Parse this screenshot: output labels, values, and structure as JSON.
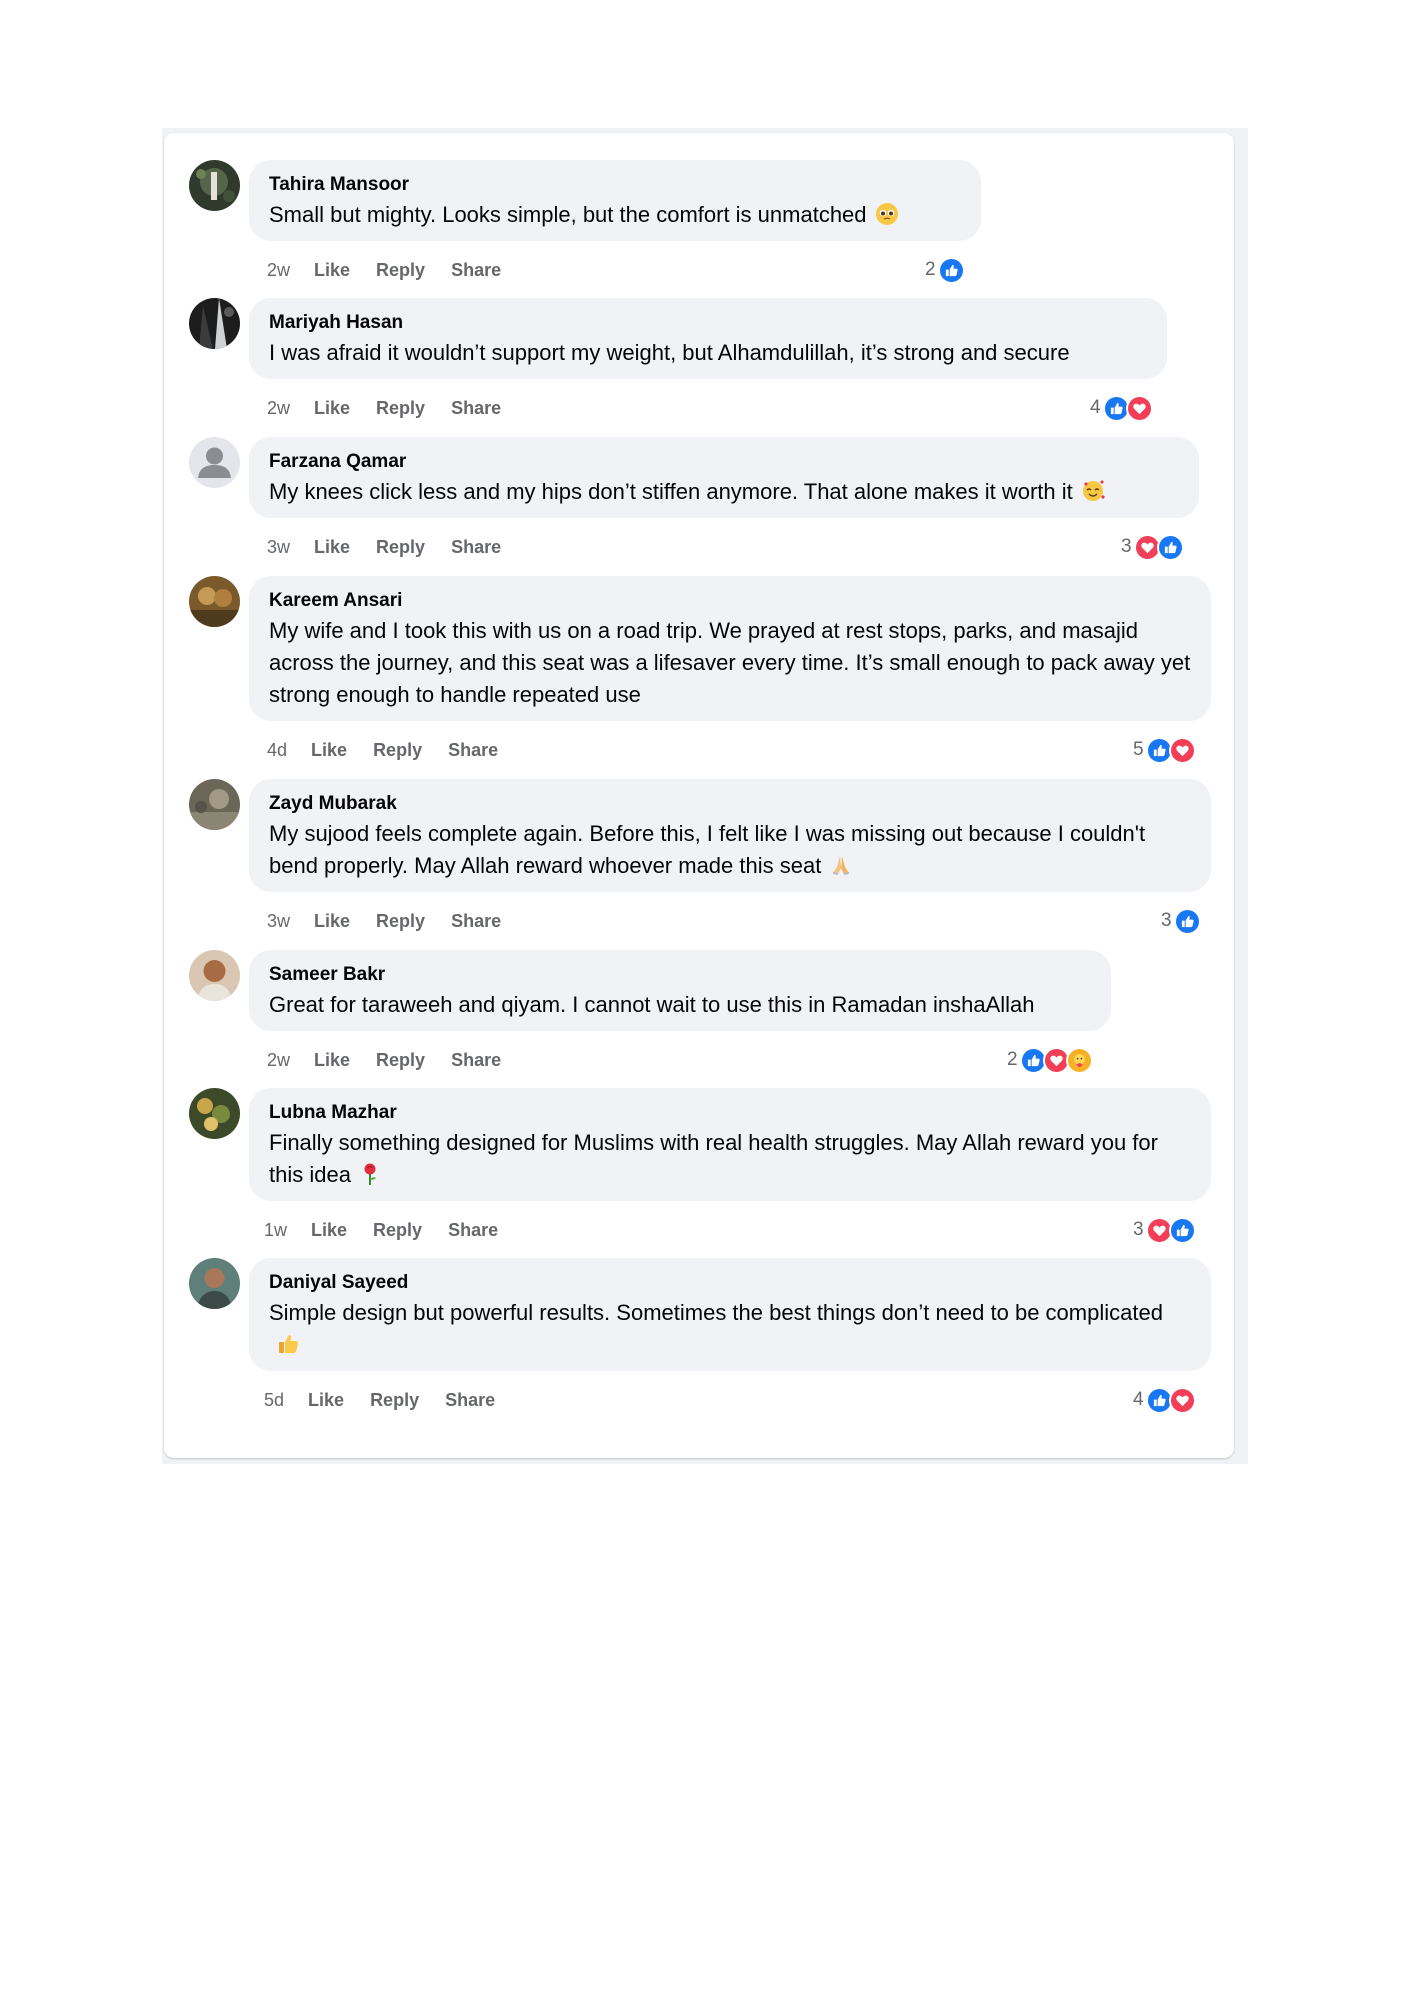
{
  "comments": [
    {
      "author": "Tahira Mansoor",
      "text": "Small but mighty. Looks simple, but the comfort is unmatched",
      "emoji": "pleading-face-emoji",
      "time": "2w",
      "like_label": "Like",
      "reply_label": "Reply",
      "share_label": "Share",
      "reaction_count": "2",
      "reactions": [
        "like"
      ]
    },
    {
      "author": "Mariyah Hasan",
      "text": "I was afraid it wouldn’t support my weight, but Alhamdulillah, it’s strong and secure",
      "emoji": "",
      "time": "2w",
      "like_label": "Like",
      "reply_label": "Reply",
      "share_label": "Share",
      "reaction_count": "4",
      "reactions": [
        "like",
        "love"
      ]
    },
    {
      "author": "Farzana Qamar",
      "text": "My knees click less and my hips don’t stiffen anymore. That alone makes it worth it",
      "emoji": "smiling-face-with-hearts-emoji",
      "time": "3w",
      "like_label": "Like",
      "reply_label": "Reply",
      "share_label": "Share",
      "reaction_count": "3",
      "reactions": [
        "love",
        "like"
      ]
    },
    {
      "author": "Kareem Ansari",
      "text": "My wife and I took this with us on a road trip. We prayed at rest stops, parks, and masajid across the journey, and this seat was a lifesaver every time. It’s small enough to pack away yet strong enough to handle repeated use",
      "emoji": "",
      "time": "4d",
      "like_label": "Like",
      "reply_label": "Reply",
      "share_label": "Share",
      "reaction_count": "5",
      "reactions": [
        "like",
        "love"
      ]
    },
    {
      "author": "Zayd Mubarak",
      "text": "My sujood feels complete again. Before this, I felt like I was missing out because I couldn't bend properly. May Allah reward whoever made this seat",
      "emoji": "folded-hands-emoji",
      "time": "3w",
      "like_label": "Like",
      "reply_label": "Reply",
      "share_label": "Share",
      "reaction_count": "3",
      "reactions": [
        "like"
      ]
    },
    {
      "author": "Sameer Bakr",
      "text": "Great for taraweeh and qiyam. I cannot wait to use this in Ramadan inshaAllah",
      "emoji": "",
      "time": "2w",
      "like_label": "Like",
      "reply_label": "Reply",
      "share_label": "Share",
      "reaction_count": "2",
      "reactions": [
        "like",
        "love",
        "care"
      ]
    },
    {
      "author": "Lubna Mazhar",
      "text": "Finally something designed for Muslims with real health struggles. May Allah reward you for this idea",
      "emoji": "rose-emoji",
      "time": "1w",
      "like_label": "Like",
      "reply_label": "Reply",
      "share_label": "Share",
      "reaction_count": "3",
      "reactions": [
        "love",
        "like"
      ]
    },
    {
      "author": "Daniyal Sayeed",
      "text": "Simple design but powerful results. Sometimes the best things don’t need to be complicated",
      "emoji": "thumbs-up-emoji",
      "time": "5d",
      "like_label": "Like",
      "reply_label": "Reply",
      "share_label": "Share",
      "reaction_count": "4",
      "reactions": [
        "like",
        "love"
      ]
    }
  ],
  "colors": {
    "bubble": "#f0f2f5",
    "meta_text": "#65676b",
    "like_blue": "#1877f2",
    "love_red": "#f33e58"
  }
}
